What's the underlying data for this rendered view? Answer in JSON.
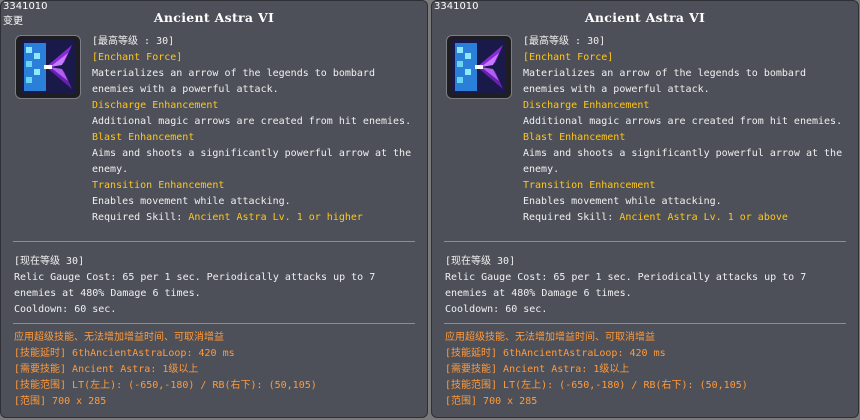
{
  "colors": {
    "panel_bg": "#4d5058",
    "highlight": "#ffc61a",
    "extra": "#ff9a3c",
    "text": "#f0f0f0"
  },
  "panels": [
    {
      "skill_id": "3341010",
      "change_label": "变更",
      "title": "Ancient Astra VI",
      "icon": "ancient-astra-skill-icon",
      "max_level": "[最高等级 : 30]",
      "enchant": "[Enchant Force]",
      "desc1": "Materializes an arrow of the legends to bombard",
      "desc2": "enemies with a powerful attack.",
      "h1": "Discharge Enhancement",
      "h1_desc": "Additional magic arrows are created from hit enemies.",
      "h2": "Blast Enhancement",
      "h2_desc1": "Aims and shoots a significantly powerful arrow at the",
      "h2_desc2": "enemy.",
      "h3": "Transition Enhancement",
      "h3_desc": "Enables movement while attacking.",
      "req_label": "Required Skill: ",
      "req_value": "Ancient Astra Lv. 1 or higher",
      "cur_level": "[现在等级 30]",
      "effect1": "Relic Gauge Cost: 65 per 1 sec. Periodically attacks up to 7",
      "effect2": "enemies at 480% Damage 6 times.",
      "effect3": "Cooldown: 60 sec.",
      "extra1": "应用超级技能、无法增加增益时间、可取消增益",
      "extra2": "[技能延时] 6thAncientAstraLoop: 420 ms",
      "extra3": "[需要技能] Ancient Astra: 1级以上",
      "extra4": "[技能范围] LT(左上): (-650,-180) / RB(右下): (50,105)",
      "extra5": "[范围] 700 x 285"
    },
    {
      "skill_id": "3341010",
      "change_label": "",
      "title": "Ancient Astra VI",
      "icon": "ancient-astra-skill-icon",
      "max_level": "[最高等级 : 30]",
      "enchant": "[Enchant Force]",
      "desc1": "Materializes an arrow of the legends to bombard",
      "desc2": "enemies with a powerful attack.",
      "h1": "Discharge Enhancement",
      "h1_desc": "Additional magic arrows are created from hit enemies.",
      "h2": "Blast Enhancement",
      "h2_desc1": "Aims and shoots a significantly powerful arrow at the",
      "h2_desc2": "enemy.",
      "h3": "Transition Enhancement",
      "h3_desc": "Enables movement while attacking.",
      "req_label": "Required Skill: ",
      "req_value": "Ancient Astra Lv. 1 or above",
      "cur_level": "[现在等级 30]",
      "effect1": "Relic Gauge Cost: 65 per 1 sec. Periodically attacks up to 7",
      "effect2": "enemies at 480% Damage 6 times.",
      "effect3": "Cooldown: 60 sec.",
      "extra1": "应用超级技能、无法增加增益时间、可取消增益",
      "extra2": "[技能延时] 6thAncientAstraLoop: 420 ms",
      "extra3": "[需要技能] Ancient Astra: 1级以上",
      "extra4": "[技能范围] LT(左上): (-650,-180) / RB(右下): (50,105)",
      "extra5": "[范围] 700 x 285"
    }
  ]
}
